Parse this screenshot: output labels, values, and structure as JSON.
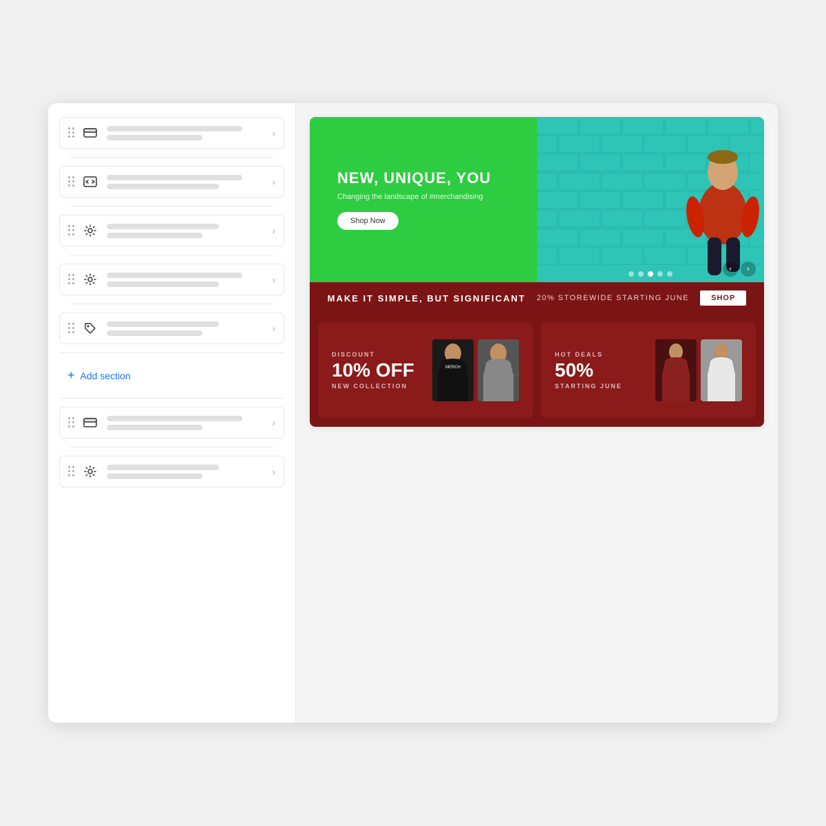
{
  "sidebar": {
    "sections_above": [
      {
        "id": "section-1",
        "icon": "image-banner-icon",
        "icon_type": "banner"
      },
      {
        "id": "section-2",
        "icon": "code-icon",
        "icon_type": "code"
      },
      {
        "id": "section-3",
        "icon": "gear-icon",
        "icon_type": "gear"
      },
      {
        "id": "section-4",
        "icon": "gear-icon-2",
        "icon_type": "gear"
      },
      {
        "id": "section-5",
        "icon": "tag-icon",
        "icon_type": "tag"
      }
    ],
    "add_section_label": "Add section",
    "sections_below": [
      {
        "id": "section-6",
        "icon": "image-banner-icon-2",
        "icon_type": "banner"
      },
      {
        "id": "section-7",
        "icon": "gear-icon-3",
        "icon_type": "gear"
      }
    ]
  },
  "hero": {
    "tagline": "NEW, UNIQUE, YOU",
    "subtitle": "Changing the landscape of #merchandising",
    "cta_button": "Shop Now",
    "nav_dots": 5,
    "active_dot": 2
  },
  "announcement_bar": {
    "main_text": "MAKE IT SIMPLE, BUT SIGNIFICANT",
    "sub_text": "20% storewide starting June",
    "shop_button": "SHOP"
  },
  "promo_cards": [
    {
      "id": "promo-1",
      "label": "DISCOUNT",
      "discount": "10% OFF",
      "collection": "NEW COLLECTION"
    },
    {
      "id": "promo-2",
      "label": "HOT DEALS",
      "discount": "50%",
      "collection": "STARTING JUNE"
    }
  ],
  "colors": {
    "hero_green": "#2ecc40",
    "hero_teal": "#2ec4c4",
    "dark_red": "#7b1414",
    "sidebar_border": "#e8e8e8",
    "link_blue": "#1a73e8"
  }
}
